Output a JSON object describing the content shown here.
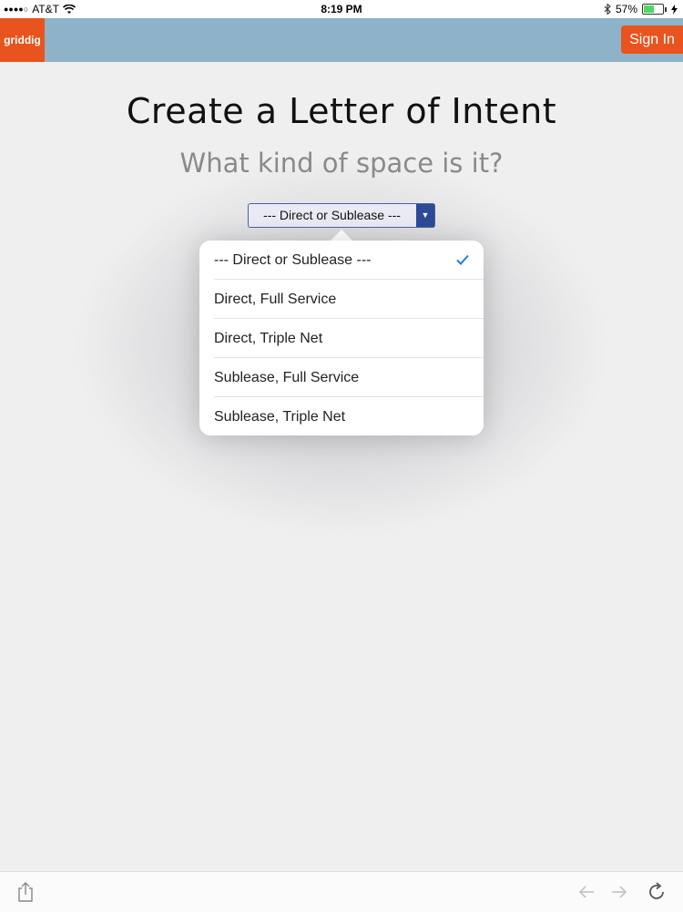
{
  "status_bar": {
    "carrier": "AT&T",
    "signal_dots": "●●●●○",
    "time": "8:19 PM",
    "battery_percent": "57%",
    "battery_level": 0.57
  },
  "header": {
    "logo_text": "griddig",
    "sign_in_label": "Sign In",
    "colors": {
      "bar": "#8eb2c7",
      "accent": "#e9531d"
    }
  },
  "main": {
    "title": "Create a Letter of Intent",
    "subtitle": "What kind of space is it?"
  },
  "select": {
    "selected_value": "--- Direct or Sublease ---",
    "options": [
      {
        "label": "--- Direct or Sublease ---",
        "checked": true
      },
      {
        "label": "Direct, Full Service",
        "checked": false
      },
      {
        "label": "Direct, Triple Net",
        "checked": false
      },
      {
        "label": "Sublease, Full Service",
        "checked": false
      },
      {
        "label": "Sublease, Triple Net",
        "checked": false
      }
    ]
  },
  "toolbar": {
    "icons": [
      "share-icon",
      "back-icon",
      "forward-icon",
      "reload-icon"
    ]
  }
}
